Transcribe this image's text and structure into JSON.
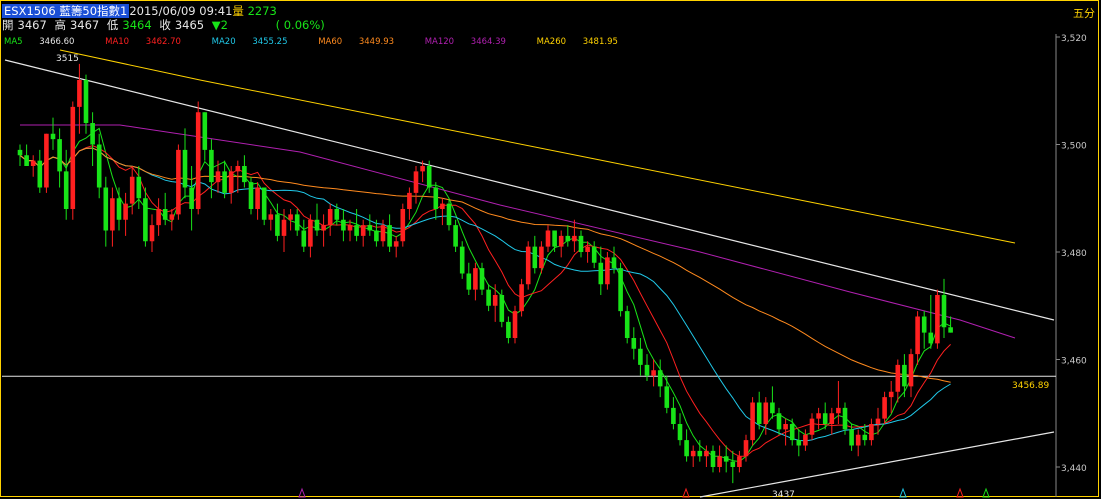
{
  "header": {
    "symbol": "ESX1506",
    "name": "藍籌50指數1",
    "datetime": "2015/06/09 09:41",
    "volume_label": "量",
    "volume": "2273",
    "open_label": "開",
    "open": "3467",
    "high_label": "高",
    "high": "3467",
    "low_label": "低",
    "low": "3464",
    "close_label": "收",
    "close": "3465",
    "change": "▼2",
    "change_pct": "( 0.06%)",
    "period": "五分"
  },
  "ma_legend": [
    {
      "label": "MA5",
      "value": "3466.60",
      "color": "#18e418"
    },
    {
      "label": "MA10",
      "value": "3462.70",
      "color": "#ff2020"
    },
    {
      "label": "MA20",
      "value": "3455.25",
      "color": "#20c8e8"
    },
    {
      "label": "MA60",
      "value": "3449.93",
      "color": "#ff8a1e"
    },
    {
      "label": "MA120",
      "value": "3464.39",
      "color": "#b020b0"
    },
    {
      "label": "MA260",
      "value": "3481.95",
      "color": "#ffd200"
    }
  ],
  "chart_data": {
    "type": "candlestick",
    "y_ticks": [
      "3,520",
      "3,500",
      "3,480",
      "3,460",
      "3,440"
    ],
    "ylim": [
      3435,
      3521
    ],
    "annotations": {
      "high_label": "3515",
      "low_label": "3437",
      "level_label": "3456.89",
      "level": 3456.89
    },
    "up_color": "#ff2020",
    "down_color": "#18e418",
    "candles": [
      [
        3499,
        3500,
        3496,
        3498
      ],
      [
        3498,
        3500,
        3496,
        3496
      ],
      [
        3496,
        3498,
        3494,
        3497
      ],
      [
        3497,
        3499,
        3491,
        3492
      ],
      [
        3492,
        3502,
        3491,
        3502
      ],
      [
        3502,
        3505,
        3499,
        3501
      ],
      [
        3501,
        3503,
        3492,
        3495
      ],
      [
        3495,
        3499,
        3486,
        3488
      ],
      [
        3488,
        3508,
        3486,
        3507
      ],
      [
        3507,
        3515,
        3502,
        3512
      ],
      [
        3512,
        3513,
        3502,
        3504
      ],
      [
        3504,
        3506,
        3496,
        3500
      ],
      [
        3500,
        3502,
        3490,
        3492
      ],
      [
        3492,
        3494,
        3481,
        3484
      ],
      [
        3484,
        3492,
        3481,
        3490
      ],
      [
        3490,
        3492,
        3484,
        3486
      ],
      [
        3486,
        3491,
        3483,
        3489
      ],
      [
        3489,
        3496,
        3487,
        3494
      ],
      [
        3494,
        3496,
        3488,
        3490
      ],
      [
        3490,
        3492,
        3481,
        3482
      ],
      [
        3482,
        3487,
        3480,
        3485
      ],
      [
        3485,
        3490,
        3483,
        3488
      ],
      [
        3488,
        3491,
        3485,
        3486
      ],
      [
        3486,
        3488,
        3484,
        3487
      ],
      [
        3487,
        3500,
        3486,
        3499
      ],
      [
        3499,
        3503,
        3490,
        3492
      ],
      [
        3492,
        3496,
        3484,
        3488
      ],
      [
        3488,
        3508,
        3487,
        3506
      ],
      [
        3506,
        3506,
        3497,
        3499
      ],
      [
        3499,
        3501,
        3490,
        3493
      ],
      [
        3493,
        3497,
        3491,
        3495
      ],
      [
        3495,
        3497,
        3490,
        3491
      ],
      [
        3491,
        3496,
        3489,
        3495
      ],
      [
        3495,
        3497,
        3491,
        3496
      ],
      [
        3496,
        3498,
        3492,
        3493
      ],
      [
        3493,
        3494,
        3487,
        3488
      ],
      [
        3488,
        3493,
        3486,
        3492
      ],
      [
        3492,
        3492,
        3485,
        3486
      ],
      [
        3486,
        3488,
        3484,
        3487
      ],
      [
        3487,
        3489,
        3482,
        3483
      ],
      [
        3483,
        3488,
        3480,
        3486
      ],
      [
        3486,
        3488,
        3484,
        3487
      ],
      [
        3487,
        3488,
        3483,
        3484
      ],
      [
        3484,
        3486,
        3480,
        3481
      ],
      [
        3481,
        3487,
        3479,
        3486
      ],
      [
        3486,
        3489,
        3483,
        3484
      ],
      [
        3484,
        3487,
        3481,
        3485
      ],
      [
        3485,
        3489,
        3483,
        3488
      ],
      [
        3488,
        3489,
        3485,
        3486
      ],
      [
        3486,
        3488,
        3482,
        3484
      ],
      [
        3484,
        3486,
        3482,
        3485
      ],
      [
        3485,
        3488,
        3482,
        3483
      ],
      [
        3483,
        3486,
        3481,
        3485
      ],
      [
        3485,
        3487,
        3483,
        3484
      ],
      [
        3484,
        3486,
        3481,
        3482
      ],
      [
        3482,
        3486,
        3481,
        3485
      ],
      [
        3485,
        3487,
        3480,
        3481
      ],
      [
        3481,
        3483,
        3479,
        3482
      ],
      [
        3482,
        3489,
        3481,
        3488
      ],
      [
        3488,
        3492,
        3486,
        3491
      ],
      [
        3491,
        3496,
        3489,
        3495
      ],
      [
        3495,
        3497,
        3493,
        3496
      ],
      [
        3496,
        3497,
        3491,
        3492
      ],
      [
        3492,
        3493,
        3486,
        3488
      ],
      [
        3488,
        3490,
        3485,
        3489
      ],
      [
        3489,
        3490,
        3484,
        3485
      ],
      [
        3485,
        3486,
        3480,
        3481
      ],
      [
        3481,
        3482,
        3475,
        3476
      ],
      [
        3476,
        3478,
        3472,
        3473
      ],
      [
        3473,
        3478,
        3471,
        3477
      ],
      [
        3477,
        3478,
        3472,
        3473
      ],
      [
        3473,
        3474,
        3469,
        3470
      ],
      [
        3470,
        3474,
        3467,
        3472
      ],
      [
        3472,
        3473,
        3466,
        3467
      ],
      [
        3467,
        3468,
        3463,
        3464
      ],
      [
        3464,
        3470,
        3463,
        3469
      ],
      [
        3469,
        3475,
        3468,
        3474
      ],
      [
        3474,
        3482,
        3473,
        3481
      ],
      [
        3481,
        3483,
        3476,
        3477
      ],
      [
        3477,
        3482,
        3476,
        3481
      ],
      [
        3481,
        3485,
        3480,
        3484
      ],
      [
        3484,
        3484,
        3480,
        3481
      ],
      [
        3481,
        3484,
        3479,
        3483
      ],
      [
        3483,
        3485,
        3481,
        3482
      ],
      [
        3482,
        3486,
        3480,
        3483
      ],
      [
        3483,
        3484,
        3479,
        3480
      ],
      [
        3480,
        3482,
        3478,
        3481
      ],
      [
        3481,
        3482,
        3477,
        3478
      ],
      [
        3478,
        3481,
        3472,
        3474
      ],
      [
        3474,
        3480,
        3473,
        3479
      ],
      [
        3479,
        3481,
        3476,
        3477
      ],
      [
        3477,
        3478,
        3468,
        3469
      ],
      [
        3469,
        3470,
        3463,
        3464
      ],
      [
        3464,
        3466,
        3460,
        3462
      ],
      [
        3462,
        3464,
        3457,
        3459
      ],
      [
        3459,
        3461,
        3456,
        3457
      ],
      [
        3457,
        3460,
        3455,
        3458
      ],
      [
        3458,
        3460,
        3453,
        3455
      ],
      [
        3455,
        3457,
        3450,
        3451
      ],
      [
        3451,
        3453,
        3447,
        3448
      ],
      [
        3448,
        3450,
        3444,
        3445
      ],
      [
        3445,
        3447,
        3441,
        3442
      ],
      [
        3442,
        3444,
        3440,
        3443
      ],
      [
        3443,
        3445,
        3441,
        3442
      ],
      [
        3442,
        3444,
        3440,
        3443
      ],
      [
        3443,
        3444,
        3439,
        3440
      ],
      [
        3440,
        3444,
        3439,
        3442
      ],
      [
        3442,
        3444,
        3439,
        3441
      ],
      [
        3441,
        3443,
        3437,
        3440
      ],
      [
        3440,
        3443,
        3439,
        3442
      ],
      [
        3442,
        3446,
        3441,
        3445
      ],
      [
        3445,
        3453,
        3444,
        3452
      ],
      [
        3452,
        3454,
        3447,
        3448
      ],
      [
        3448,
        3453,
        3446,
        3452
      ],
      [
        3452,
        3455,
        3449,
        3450
      ],
      [
        3450,
        3451,
        3446,
        3447
      ],
      [
        3447,
        3449,
        3444,
        3448
      ],
      [
        3448,
        3449,
        3444,
        3445
      ],
      [
        3445,
        3447,
        3442,
        3444
      ],
      [
        3444,
        3447,
        3443,
        3446
      ],
      [
        3446,
        3450,
        3445,
        3449
      ],
      [
        3449,
        3451,
        3447,
        3450
      ],
      [
        3450,
        3452,
        3447,
        3448
      ],
      [
        3448,
        3451,
        3446,
        3450
      ],
      [
        3450,
        3456,
        3448,
        3451
      ],
      [
        3451,
        3452,
        3446,
        3447
      ],
      [
        3447,
        3448,
        3443,
        3444
      ],
      [
        3444,
        3447,
        3442,
        3446
      ],
      [
        3446,
        3448,
        3444,
        3445
      ],
      [
        3445,
        3449,
        3444,
        3448
      ],
      [
        3448,
        3451,
        3446,
        3449
      ],
      [
        3449,
        3454,
        3448,
        3453
      ],
      [
        3453,
        3456,
        3450,
        3454
      ],
      [
        3454,
        3460,
        3452,
        3459
      ],
      [
        3459,
        3461,
        3453,
        3455
      ],
      [
        3455,
        3462,
        3453,
        3461
      ],
      [
        3461,
        3469,
        3459,
        3468
      ],
      [
        3468,
        3469,
        3462,
        3465
      ],
      [
        3465,
        3472,
        3462,
        3463
      ],
      [
        3463,
        3473,
        3462,
        3472
      ],
      [
        3472,
        3475,
        3464,
        3466
      ],
      [
        3466,
        3468,
        3465,
        3465
      ]
    ]
  }
}
